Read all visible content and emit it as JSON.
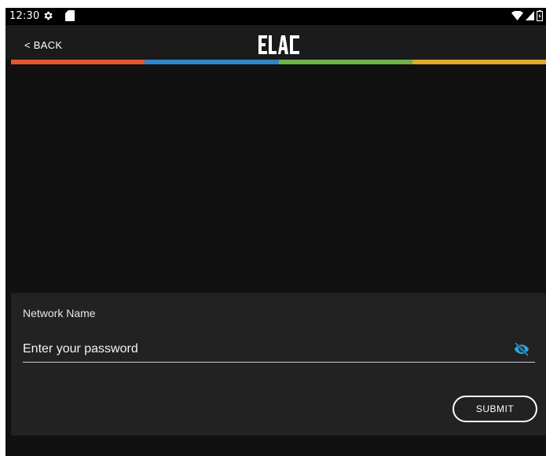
{
  "status_bar": {
    "time": "12:30",
    "icons_left": [
      "gear-icon",
      "sd-card-icon"
    ],
    "icons_right": [
      "wifi-icon",
      "signal-icon",
      "battery-icon"
    ]
  },
  "app_bar": {
    "back_label": "< BACK",
    "logo_text": "ELAC"
  },
  "stripe_colors": [
    "#e0582a",
    "#2f86c9",
    "#6cb44a",
    "#e0aa2e"
  ],
  "form": {
    "network_label": "Network Name",
    "password_placeholder": "Enter your password",
    "password_value": "",
    "visibility_icon": "eye-off-icon",
    "submit_label": "SUBMIT"
  },
  "colors": {
    "background": "#111111",
    "app_bar": "#1b1b1b",
    "card": "#222222",
    "accent_eye": "#2aa3d9"
  }
}
